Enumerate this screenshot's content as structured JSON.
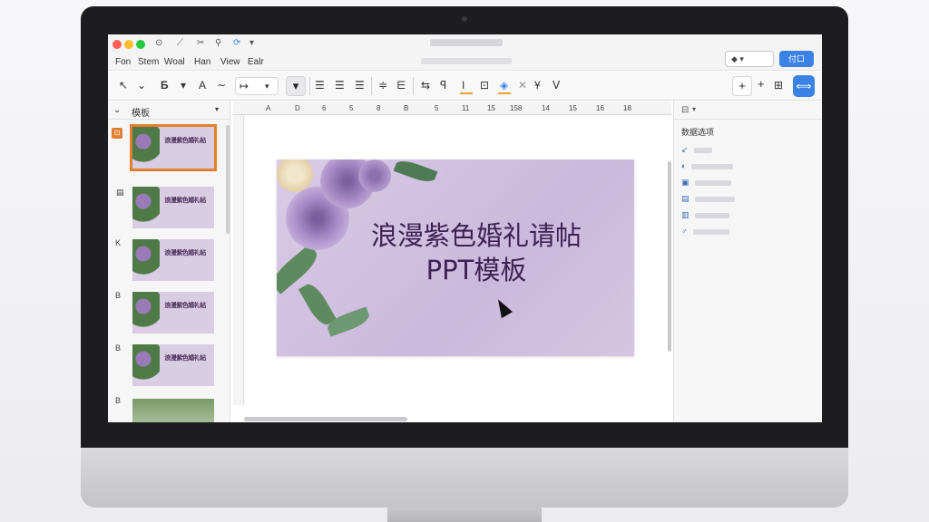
{
  "window": {
    "menu": [
      "Fon",
      "Stem",
      "Woal",
      "Han",
      "View",
      "Ealr"
    ],
    "share_select": "◆ ▾",
    "share_button": "付口"
  },
  "toolbar": {
    "icons": [
      "cursor-icon",
      "undo-icon",
      "bold-icon",
      "font-color-icon",
      "wave-icon",
      "arrow-icon",
      "filter-icon",
      "align-left-icon",
      "align-center-icon",
      "align-right-icon",
      "line-spacing-icon",
      "paragraph-icon",
      "text-box-icon",
      "underline-icon",
      "border-icon",
      "paint-icon",
      "shape-icon",
      "strike-icon",
      "add-icon",
      "insert-icon",
      "table-icon",
      "sync-icon"
    ]
  },
  "left_panel": {
    "header": "模板",
    "slides": [
      {
        "num": "",
        "title": "浪漫紫色婚礼帖"
      },
      {
        "num": "▤",
        "title": "浪漫紫色婚礼帖"
      },
      {
        "num": "K",
        "title": "浪漫紫色婚礼帖"
      },
      {
        "num": "B",
        "title": "浪漫紫色婚礼帖"
      },
      {
        "num": "B",
        "title": "浪漫紫色婚礼帖"
      },
      {
        "num": "B",
        "title": ""
      }
    ]
  },
  "ruler": {
    "ticks": [
      "A",
      "D",
      "6",
      "5",
      "8",
      "B",
      "5",
      "11",
      "15",
      "158",
      "14",
      "15",
      "16",
      "18"
    ]
  },
  "slide": {
    "title_line1": "浪漫紫色婚礼请帖",
    "title_line2": "PPT模板"
  },
  "right_panel": {
    "title": "数据选项",
    "rows": [
      "↙",
      "◐",
      "▣",
      "▤",
      "▥",
      "♂"
    ]
  },
  "colors": {
    "accent": "#3b82e6",
    "selection": "#e07f2f",
    "slide_bg": "#d2c2e0",
    "title_text": "#3d2352"
  }
}
